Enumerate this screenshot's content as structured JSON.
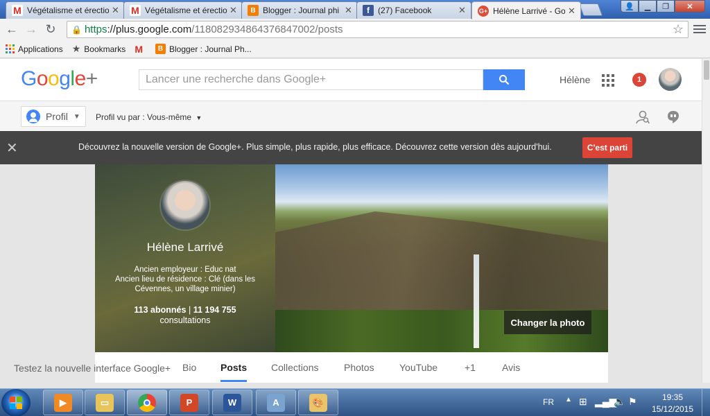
{
  "browser": {
    "tabs": [
      {
        "label": "Végétalisme et érectio",
        "favicon": "gmail-icon",
        "fav_char": "M"
      },
      {
        "label": "Végétalisme et érectio",
        "favicon": "gmail-icon",
        "fav_char": "M"
      },
      {
        "label": "Blogger : Journal phi",
        "favicon": "blogger-icon",
        "fav_char": "B"
      },
      {
        "label": "(27) Facebook",
        "favicon": "facebook-icon",
        "fav_char": "f"
      },
      {
        "label": "Hélène Larrivé - Goog",
        "favicon": "google-plus-icon",
        "fav_char": "G+",
        "active": true
      }
    ],
    "url": {
      "secure": "https",
      "host": "://plus.google.com",
      "path": "/118082934864376847002/posts"
    },
    "bookmarks": {
      "apps": "Applications",
      "bookmarks": "Bookmarks",
      "blogger": "Blogger : Journal Ph..."
    }
  },
  "gplus": {
    "search_placeholder": "Lancer une recherche dans Google+",
    "user_name": "Hélène",
    "notification_count": "1",
    "profile_button": "Profil",
    "viewed_as_label": "Profil vu par : ",
    "viewed_as_value": "Vous-même",
    "banner": {
      "text": "Découvrez la nouvelle version de Google+.   Plus simple, plus rapide, plus efficace. Découvrez cette version dès aujourd'hui.",
      "cta": "C'est parti"
    },
    "profile": {
      "name": "Hélène Larrivé",
      "employer": "Ancien employeur : Educ nat",
      "residence_1": "Ancien lieu de résidence : Clé (dans les",
      "residence_2": "Cévennes, un village minier)",
      "followers": "113 abonnés",
      "separator": "|",
      "views": "11 194 755",
      "views_label": "consultations",
      "change_photo": "Changer la photo"
    },
    "try_new": "Testez la nouvelle interface Google+",
    "tabs": [
      "Bio",
      "Posts",
      "Collections",
      "Photos",
      "YouTube",
      "+1",
      "Avis"
    ],
    "active_tab": "Posts"
  },
  "taskbar": {
    "lang": "FR",
    "time": "19:35",
    "date": "15/12/2015"
  },
  "colors": {
    "google_blue": "#4285f4",
    "google_red": "#db4437",
    "banner_bg": "#444444"
  }
}
